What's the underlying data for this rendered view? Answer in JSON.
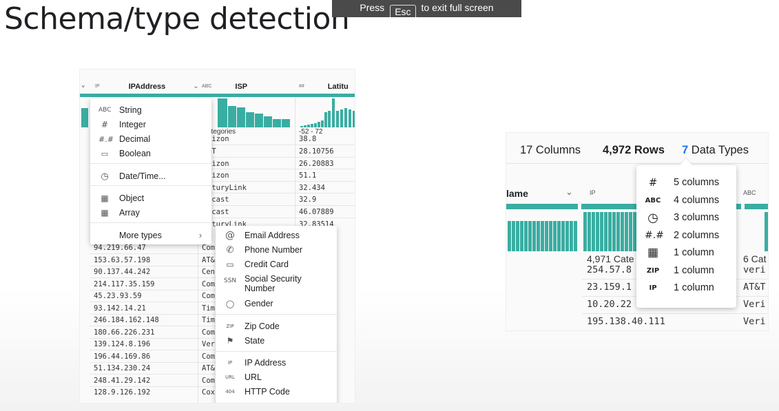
{
  "slide": {
    "title": "Schema/type detection"
  },
  "banner": {
    "press": "Press",
    "key": "Esc",
    "rest": "to exit full screen"
  },
  "left": {
    "columns": [
      {
        "type": "IP",
        "name": "IPAddress"
      },
      {
        "type": "ABC",
        "name": "ISP"
      },
      {
        "type": "##",
        "name": "Latitu"
      }
    ],
    "isp_caption": "ategories",
    "lat_caption": "-52 - 72",
    "isp_values": [
      "rizon",
      "&T",
      "rizon",
      "rizon",
      "nturyLink",
      "mcast",
      "mcast",
      "nturyLink",
      "&",
      "Com",
      "AT&",
      "Cen",
      "Com",
      "Com",
      "Tim",
      "Tim",
      "Com",
      "Ver",
      "Com",
      "AT&",
      "Com",
      "Cox"
    ],
    "lat_values": [
      "38.8",
      "28.10756",
      "26.20883",
      "51.1",
      "32.434",
      "32.9",
      "46.07889",
      "32.83514"
    ],
    "ip_values": [
      "94.219.66.47",
      "153.63.57.198",
      "90.137.44.242",
      "214.117.35.159",
      "45.23.93.59",
      "93.142.14.21",
      "246.184.162.148",
      "180.66.226.231",
      "139.124.8.196",
      "196.44.169.86",
      "51.134.230.24",
      "248.41.29.142",
      "128.9.126.192"
    ],
    "type_menu": [
      {
        "icon": "ABC",
        "label": "String"
      },
      {
        "icon": "#",
        "label": "Integer"
      },
      {
        "icon": "#.#",
        "label": "Decimal"
      },
      {
        "icon": "▭",
        "label": "Boolean"
      },
      {
        "icon": "◷",
        "label": "Date/Time..."
      },
      {
        "icon": "▦",
        "label": "Object"
      },
      {
        "icon": "▦",
        "label": "Array"
      }
    ],
    "more_types": "More types",
    "more_types_arrow": "›",
    "submenu": [
      {
        "icon": "@",
        "label": "Email Address"
      },
      {
        "icon": "✆",
        "label": "Phone Number"
      },
      {
        "icon": "▭",
        "label": "Credit Card"
      },
      {
        "icon": "SSN",
        "label": "Social Security"
      },
      {
        "icon": "◯",
        "label": "Gender"
      },
      {
        "icon": "ZIP",
        "label": "Zip Code"
      },
      {
        "icon": "⚑",
        "label": "State"
      },
      {
        "icon": "IP",
        "label": "IP Address"
      },
      {
        "icon": "URL",
        "label": "URL"
      },
      {
        "icon": "404",
        "label": "HTTP Code"
      }
    ],
    "ssn_second_line": "Number"
  },
  "right": {
    "stats": {
      "columns": "17 Columns",
      "rows": "4,972 Rows",
      "types_count": "7",
      "types_label": "Data Types"
    },
    "col_name": "lame",
    "col_chevron": "⌄",
    "col_ip": "IP",
    "col_abc": "ABC",
    "cat1": "4,971 Cate",
    "cat2": "6 Cat",
    "ip_rows": [
      "254.57.8",
      "23.159.1",
      "10.20.22",
      "195.138.40.111"
    ],
    "isp_rows": [
      "veri",
      "AT&T",
      "Veri",
      "Veri"
    ],
    "tooltip": [
      {
        "icon": "#",
        "label": "5 columns"
      },
      {
        "icon": "ABC",
        "label": "4 columns"
      },
      {
        "icon": "◷",
        "label": "3 columns"
      },
      {
        "icon": "#.#",
        "label": "2 columns"
      },
      {
        "icon": "▦",
        "label": "1 column"
      },
      {
        "icon": "ZIP",
        "label": "1 column"
      },
      {
        "icon": "IP",
        "label": "1 column"
      }
    ],
    "accent": "#1a73e8"
  },
  "colors": {
    "teal": "#3aada2"
  }
}
